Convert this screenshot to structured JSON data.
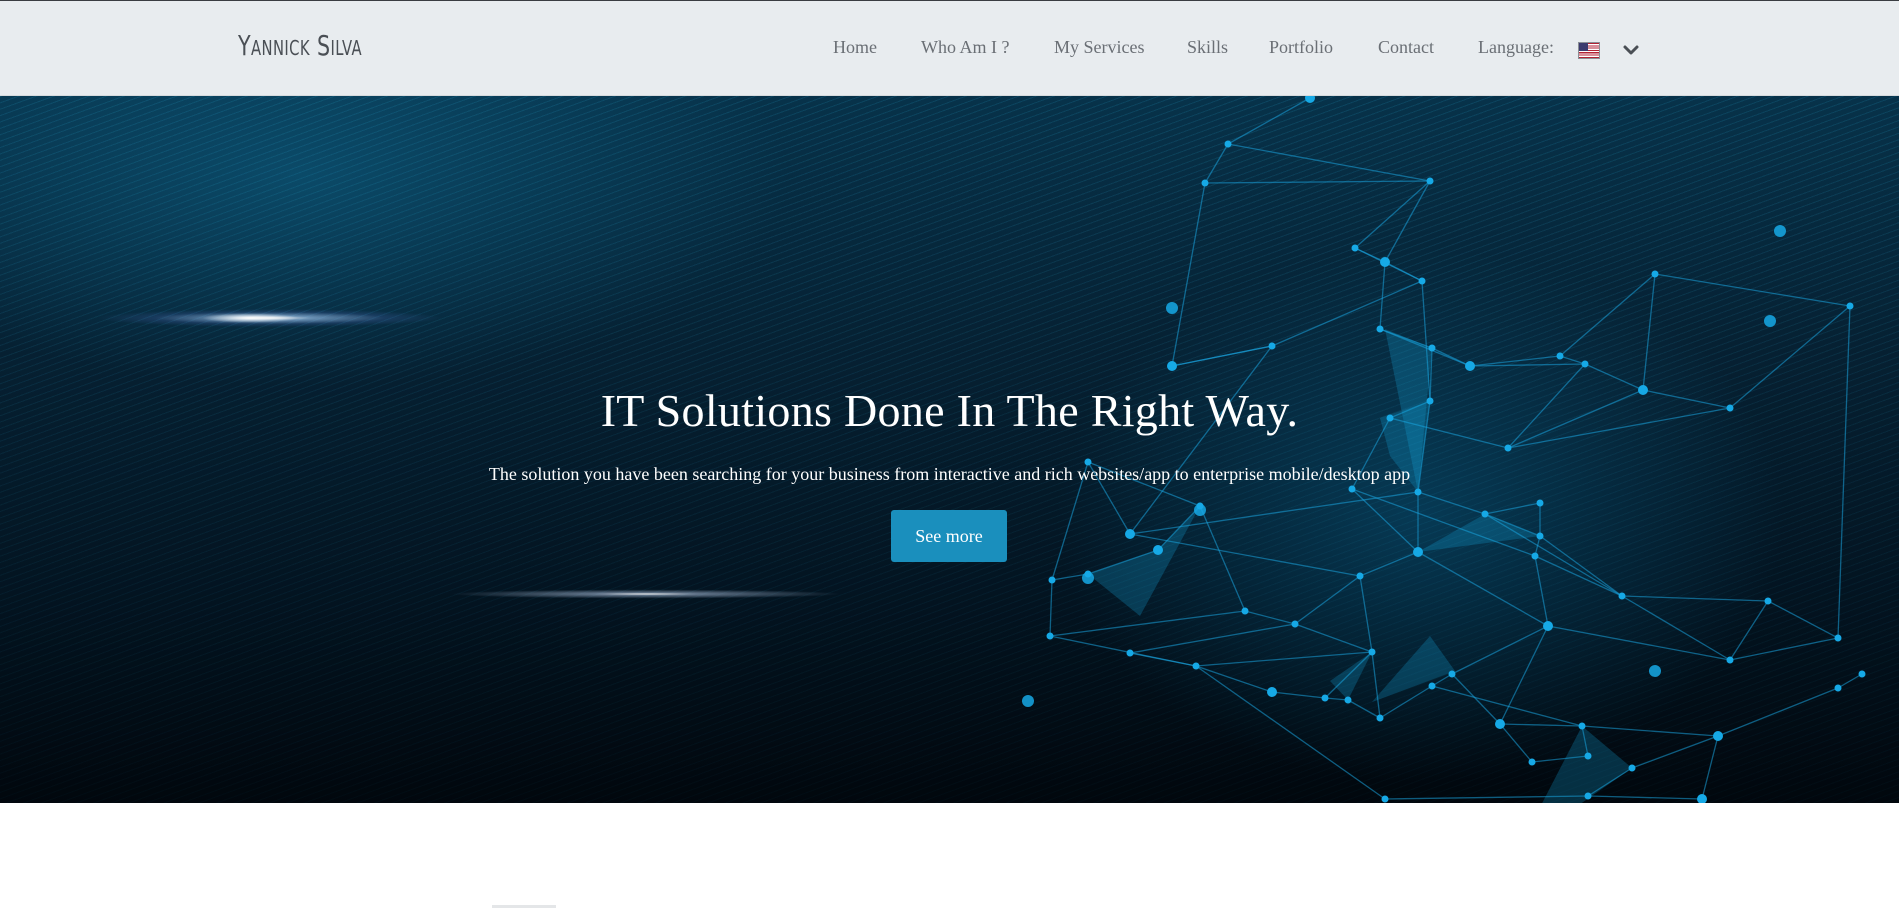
{
  "navbar": {
    "brand": "Yannick Silva",
    "items": [
      {
        "label": "Home"
      },
      {
        "label": "Who Am I ?"
      },
      {
        "label": "My Services"
      },
      {
        "label": "Skills"
      },
      {
        "label": "Portfolio"
      },
      {
        "label": "Contact"
      }
    ],
    "language_label": "Language:",
    "language_flag_icon": "us-flag-icon",
    "dropdown_icon": "chevron-down-icon"
  },
  "hero": {
    "title": "IT Solutions Done In The Right Way.",
    "subtitle": "The solution you have been searching for your business from interactive and rich websites/app to enterprise mobile/desktop app",
    "cta_label": "See more",
    "cta_color": "#1a8fbd",
    "accent_color": "#15a8e0"
  }
}
